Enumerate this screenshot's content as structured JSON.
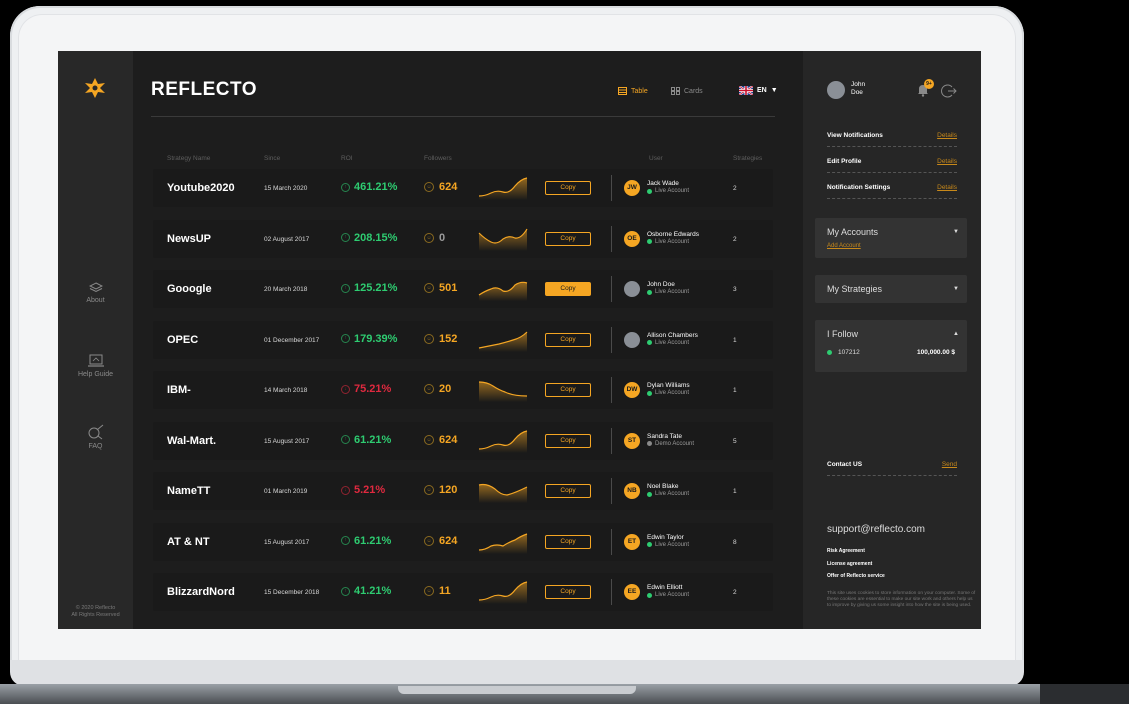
{
  "app": {
    "brand": "REFLECTO"
  },
  "header": {
    "view_table": "Table",
    "view_cards": "Cards",
    "language": "EN"
  },
  "sidebar": {
    "items": [
      {
        "label": "About"
      },
      {
        "label": "Help Guide"
      },
      {
        "label": "FAQ"
      }
    ],
    "footer_line1": "© 2020 Reflecto",
    "footer_line2": "All Rights Reserved"
  },
  "table": {
    "columns": [
      "Strategy Name",
      "Since",
      "ROI",
      "Followers",
      "User",
      "Strategies"
    ],
    "copy_label": "Copy",
    "rows": [
      {
        "name": "Youtube2020",
        "since": "15 March 2020",
        "roi": "461.21%",
        "roi_dir": "up",
        "followers": "624",
        "initials": "JW",
        "user": "Jack Wade",
        "account": "Live Account",
        "strategies": "2"
      },
      {
        "name": "NewsUP",
        "since": "02 August 2017",
        "roi": "208.15%",
        "roi_dir": "up",
        "followers": "0",
        "initials": "OE",
        "user": "Osborne Edwards",
        "account": "Live Account",
        "strategies": "2"
      },
      {
        "name": "Gooogle",
        "since": "20 March 2018",
        "roi": "125.21%",
        "roi_dir": "up",
        "followers": "501",
        "initials": "",
        "user": "John Doe",
        "account": "Live Account",
        "strategies": "3"
      },
      {
        "name": "OPEC",
        "since": "01 December 2017",
        "roi": "179.39%",
        "roi_dir": "up",
        "followers": "152",
        "initials": "",
        "user": "Allison Chambers",
        "account": "Live Account",
        "strategies": "1"
      },
      {
        "name": "IBM-",
        "since": "14 March 2018",
        "roi": "75.21%",
        "roi_dir": "down",
        "followers": "20",
        "initials": "DW",
        "user": "Dylan Williams",
        "account": "Live Account",
        "strategies": "1"
      },
      {
        "name": "Wal-Mart.",
        "since": "15 August 2017",
        "roi": "61.21%",
        "roi_dir": "up",
        "followers": "624",
        "initials": "ST",
        "user": "Sandra Tate",
        "account": "Demo Account",
        "strategies": "5"
      },
      {
        "name": "NameTT",
        "since": "01 March 2019",
        "roi": "5.21%",
        "roi_dir": "down",
        "followers": "120",
        "initials": "NB",
        "user": "Noel Blake",
        "account": "Live Account",
        "strategies": "1"
      },
      {
        "name": "AT & NT",
        "since": "15 August 2017",
        "roi": "61.21%",
        "roi_dir": "up",
        "followers": "624",
        "initials": "ET",
        "user": "Edwin Taylor",
        "account": "Live Account",
        "strategies": "8"
      },
      {
        "name": "BlizzardNord",
        "since": "15 December 2018",
        "roi": "41.21%",
        "roi_dir": "up",
        "followers": "11",
        "initials": "EE",
        "user": "Edwin Elliott",
        "account": "Live Account",
        "strategies": "2"
      }
    ]
  },
  "rpanel": {
    "user_first": "John",
    "user_last": "Doe",
    "notif_badge": "9+",
    "links": [
      {
        "label": "View Notifications",
        "action": "Details"
      },
      {
        "label": "Edit Profile",
        "action": "Details"
      },
      {
        "label": "Notification Settings",
        "action": "Details"
      }
    ],
    "my_accounts": "My Accounts",
    "add_account": "Add Account",
    "my_strategies": "My Strategies",
    "i_follow": "I Follow",
    "follow_id": "107212",
    "follow_amount": "100,000.00 $",
    "contact_label": "Contact US",
    "contact_action": "Send",
    "email": "support@reflecto.com",
    "legal": [
      "Risk Agreement",
      "License agreement",
      "Offer of Reflecto service"
    ],
    "cookie": "This site uses cookies to store information on your computer. Some of these cookies are essential to make our site work and others help us to improve by giving us some insight into how the site is being used."
  },
  "colors": {
    "accent": "#f5a623",
    "up": "#2ecc71",
    "down": "#e0293f",
    "bg": "#1d1d1d"
  }
}
